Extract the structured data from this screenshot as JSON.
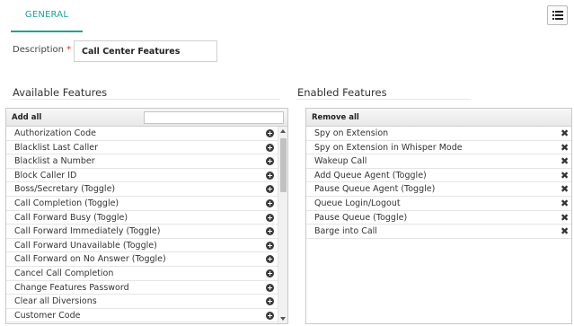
{
  "tabs": [
    {
      "label": "GENERAL",
      "active": true
    }
  ],
  "toolbar": {
    "view_icon": "list-view-icon"
  },
  "form": {
    "description_label": "Description",
    "required_mark": "*",
    "description_value": "Call Center Features"
  },
  "available": {
    "title": "Available Features",
    "add_all_label": "Add all",
    "filter_value": "",
    "row_icon": "plus-circle-icon",
    "items": [
      "Authorization Code",
      "Blacklist Last Caller",
      "Blacklist a Number",
      "Block Caller ID",
      "Boss/Secretary (Toggle)",
      "Call Completion (Toggle)",
      "Call Forward Busy (Toggle)",
      "Call Forward Immediately (Toggle)",
      "Call Forward Unavailable (Toggle)",
      "Call Forward on No Answer (Toggle)",
      "Cancel Call Completion",
      "Change Features Password",
      "Clear all Diversions",
      "Customer Code"
    ]
  },
  "enabled": {
    "title": "Enabled Features",
    "remove_all_label": "Remove all",
    "row_icon": "remove-x-icon",
    "remove_glyph": "✖",
    "items": [
      "Spy on Extension",
      "Spy on Extension in Whisper Mode",
      "Wakeup Call",
      "Add Queue Agent (Toggle)",
      "Pause Queue Agent (Toggle)",
      "Queue Login/Logout",
      "Pause Queue (Toggle)",
      "Barge into Call"
    ]
  },
  "colors": {
    "accent": "#1aa39a",
    "required": "#e0322b"
  }
}
